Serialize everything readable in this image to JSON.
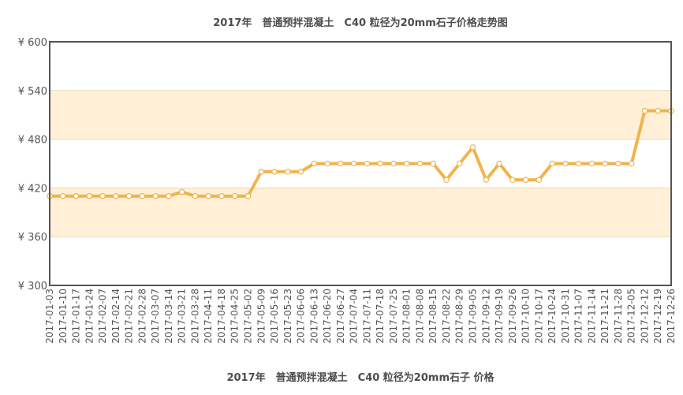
{
  "chart_data": {
    "type": "line",
    "title": "2017年　普通预拌混凝土　C40 粒径为20mm石子价格走势图",
    "xlabel": "2017年　普通预拌混凝土　C40 粒径为20mm石子 价格",
    "ylabel": "",
    "ylim": [
      300,
      600
    ],
    "yticks": [
      300,
      360,
      420,
      480,
      540,
      600
    ],
    "ytick_prefix": "¥",
    "grid": true,
    "band_color": "#fff0d7",
    "line_color": "#f1b34a",
    "categories": [
      "2017-01-03",
      "2017-01-10",
      "2017-01-17",
      "2017-01-24",
      "2017-02-07",
      "2017-02-14",
      "2017-02-21",
      "2017-02-28",
      "2017-03-07",
      "2017-03-14",
      "2017-03-21",
      "2017-03-28",
      "2017-04-11",
      "2017-04-18",
      "2017-04-25",
      "2017-05-02",
      "2017-05-09",
      "2017-05-16",
      "2017-05-23",
      "2017-06-06",
      "2017-06-13",
      "2017-06-20",
      "2017-06-27",
      "2017-07-04",
      "2017-07-11",
      "2017-07-18",
      "2017-07-25",
      "2017-08-01",
      "2017-08-08",
      "2017-08-15",
      "2017-08-22",
      "2017-08-29",
      "2017-09-05",
      "2017-09-12",
      "2017-09-19",
      "2017-09-26",
      "2017-10-10",
      "2017-10-17",
      "2017-10-24",
      "2017-10-31",
      "2017-11-07",
      "2017-11-14",
      "2017-11-21",
      "2017-11-28",
      "2017-12-05",
      "2017-12-12",
      "2017-12-19",
      "2017-12-26"
    ],
    "values": [
      410,
      410,
      410,
      410,
      410,
      410,
      410,
      410,
      410,
      410,
      415,
      410,
      410,
      410,
      410,
      410,
      440,
      440,
      440,
      440,
      450,
      450,
      450,
      450,
      450,
      450,
      450,
      450,
      450,
      450,
      430,
      450,
      470,
      430,
      450,
      430,
      430,
      430,
      450,
      450,
      450,
      450,
      450,
      450,
      450,
      515,
      515,
      515
    ]
  }
}
